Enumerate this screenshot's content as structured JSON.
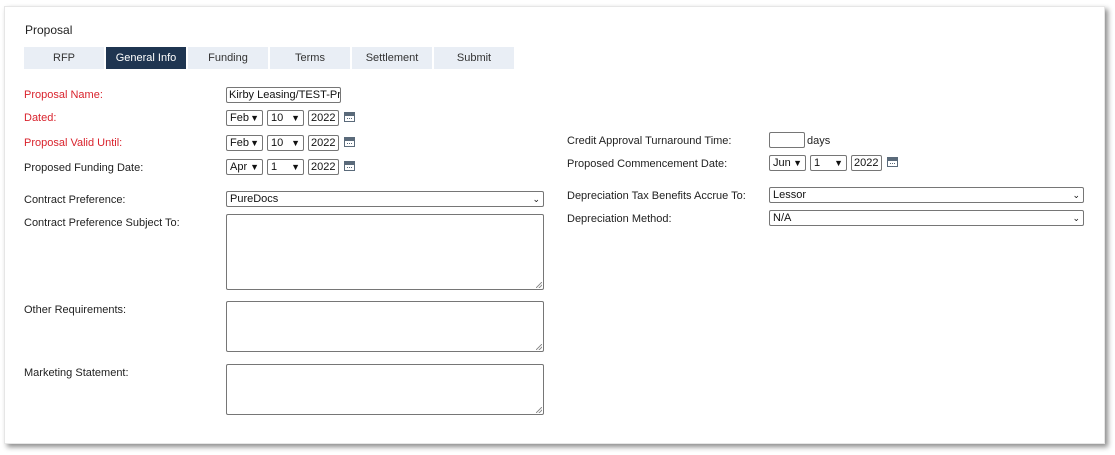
{
  "title": "Proposal",
  "tabs": [
    "RFP",
    "General Info",
    "Funding",
    "Terms",
    "Settlement",
    "Submit"
  ],
  "active_tab": "General Info",
  "colors": {
    "active_tab": "#1f3551",
    "tab": "#e9eef5",
    "required_label": "#d9232d"
  },
  "left": {
    "proposal_name": {
      "label": "Proposal Name:",
      "value": "Kirby Leasing/TEST-Prev"
    },
    "dated": {
      "label": "Dated:",
      "month": "Feb",
      "day": "10",
      "year": "2022"
    },
    "valid_until": {
      "label": "Proposal Valid Until:",
      "month": "Feb",
      "day": "10",
      "year": "2022"
    },
    "funding_date": {
      "label": "Proposed Funding Date:",
      "month": "Apr",
      "day": "1",
      "year": "2022"
    },
    "contract_pref": {
      "label": "Contract Preference:",
      "value": "PureDocs"
    },
    "contract_subject": {
      "label": "Contract Preference Subject To:"
    },
    "other_req": {
      "label": "Other Requirements:"
    },
    "marketing": {
      "label": "Marketing Statement:"
    }
  },
  "right": {
    "credit_turnaround": {
      "label": "Credit Approval Turnaround Time:",
      "value": "",
      "unit": "days"
    },
    "commencement": {
      "label": "Proposed Commencement Date:",
      "month": "Jun",
      "day": "1",
      "year": "2022"
    },
    "dep_tax": {
      "label": "Depreciation Tax Benefits Accrue To:",
      "value": "Lessor"
    },
    "dep_method": {
      "label": "Depreciation Method:",
      "value": "N/A"
    }
  },
  "icons": {
    "calendar": "calendar-icon",
    "dropdown": "chevron-down-icon",
    "resize": "resize-grip-icon"
  }
}
